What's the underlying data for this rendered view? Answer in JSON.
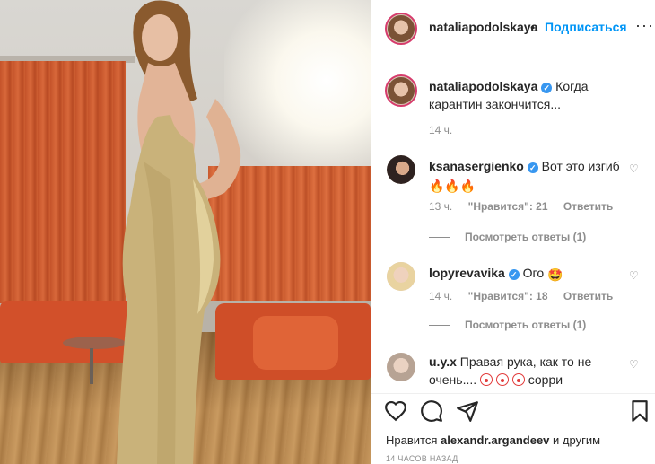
{
  "post": {
    "author": "nataliapodolskaya",
    "follow_label": "Подписаться",
    "dot": "•",
    "more": "···",
    "caption_user": "nataliapodolskaya",
    "caption": "Когда карантин закончится...",
    "caption_time": "14 ч."
  },
  "comments": [
    {
      "user": "ksanasergienko",
      "text": "Вот это изгиб",
      "emoji": "🔥🔥🔥",
      "time": "13 ч.",
      "likes": "\"Нравится\": 21",
      "reply": "Ответить",
      "view_replies": "Посмотреть ответы (1)"
    },
    {
      "user": "lopyrevavika",
      "text": "Ого",
      "emoji": "🤩",
      "time": "14 ч.",
      "likes": "\"Нравится\": 18",
      "reply": "Ответить",
      "view_replies": "Посмотреть ответы (1)"
    },
    {
      "user": "u.y.x",
      "text": "Правая рука, как то не очень....",
      "text_end": "сорри"
    }
  ],
  "footer": {
    "likes_prefix": "Нравится",
    "likes_user": "alexandr.argandeev",
    "likes_suffix": "и другим",
    "timestamp": "14 ЧАСОВ НАЗАД"
  },
  "icons": {
    "verified": "✓",
    "heart": "♡"
  },
  "colors": {
    "accent": "#0095f6",
    "verified": "#3897f0",
    "muted": "#8e8e8e"
  }
}
